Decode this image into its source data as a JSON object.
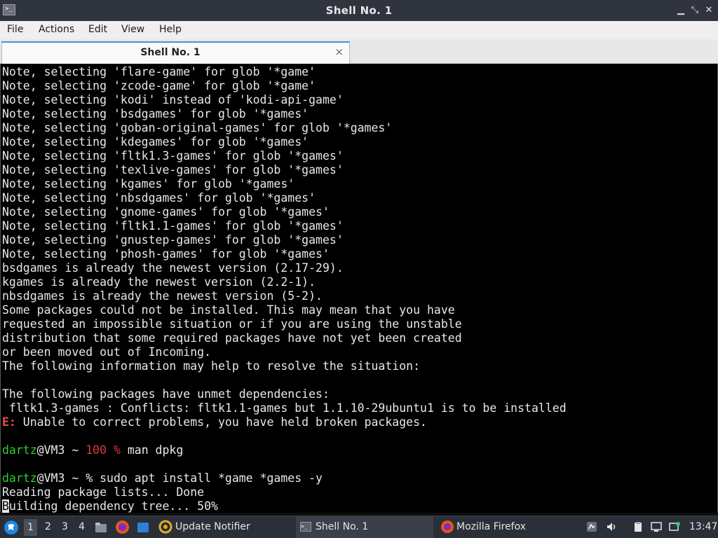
{
  "window": {
    "title": "Shell No. 1",
    "icon": "terminal-icon",
    "controls": [
      "minimize-icon",
      "maximize-icon",
      "close-icon"
    ]
  },
  "menu": [
    "File",
    "Actions",
    "Edit",
    "View",
    "Help"
  ],
  "tab": {
    "label": "Shell No. 1",
    "close": "×"
  },
  "terminal": {
    "lines": [
      {
        "segments": [
          {
            "text": "Note, selecting 'flare-game' for glob '*game'"
          }
        ]
      },
      {
        "segments": [
          {
            "text": "Note, selecting 'zcode-game' for glob '*game'"
          }
        ]
      },
      {
        "segments": [
          {
            "text": "Note, selecting 'kodi' instead of 'kodi-api-game'"
          }
        ]
      },
      {
        "segments": [
          {
            "text": "Note, selecting 'bsdgames' for glob '*games'"
          }
        ]
      },
      {
        "segments": [
          {
            "text": "Note, selecting 'goban-original-games' for glob '*games'"
          }
        ]
      },
      {
        "segments": [
          {
            "text": "Note, selecting 'kdegames' for glob '*games'"
          }
        ]
      },
      {
        "segments": [
          {
            "text": "Note, selecting 'fltk1.3-games' for glob '*games'"
          }
        ]
      },
      {
        "segments": [
          {
            "text": "Note, selecting 'texlive-games' for glob '*games'"
          }
        ]
      },
      {
        "segments": [
          {
            "text": "Note, selecting 'kgames' for glob '*games'"
          }
        ]
      },
      {
        "segments": [
          {
            "text": "Note, selecting 'nbsdgames' for glob '*games'"
          }
        ]
      },
      {
        "segments": [
          {
            "text": "Note, selecting 'gnome-games' for glob '*games'"
          }
        ]
      },
      {
        "segments": [
          {
            "text": "Note, selecting 'fltk1.1-games' for glob '*games'"
          }
        ]
      },
      {
        "segments": [
          {
            "text": "Note, selecting 'gnustep-games' for glob '*games'"
          }
        ]
      },
      {
        "segments": [
          {
            "text": "Note, selecting 'phosh-games' for glob '*games'"
          }
        ]
      },
      {
        "segments": [
          {
            "text": "bsdgames is already the newest version (2.17-29)."
          }
        ]
      },
      {
        "segments": [
          {
            "text": "kgames is already the newest version (2.2-1)."
          }
        ]
      },
      {
        "segments": [
          {
            "text": "nbsdgames is already the newest version (5-2)."
          }
        ]
      },
      {
        "segments": [
          {
            "text": "Some packages could not be installed. This may mean that you have"
          }
        ]
      },
      {
        "segments": [
          {
            "text": "requested an impossible situation or if you are using the unstable"
          }
        ]
      },
      {
        "segments": [
          {
            "text": "distribution that some required packages have not yet been created"
          }
        ]
      },
      {
        "segments": [
          {
            "text": "or been moved out of Incoming."
          }
        ]
      },
      {
        "segments": [
          {
            "text": "The following information may help to resolve the situation:"
          }
        ]
      },
      {
        "segments": [
          {
            "text": ""
          }
        ]
      },
      {
        "segments": [
          {
            "text": "The following packages have unmet dependencies:"
          }
        ]
      },
      {
        "segments": [
          {
            "text": " fltk1.3-games : Conflicts: fltk1.1-games but 1.1.10-29ubuntu1 is to be installed"
          }
        ]
      },
      {
        "segments": [
          {
            "text": "E:",
            "cls": "err"
          },
          {
            "text": " Unable to correct problems, you have held broken packages."
          }
        ]
      },
      {
        "segments": [
          {
            "text": ""
          }
        ]
      },
      {
        "segments": [
          {
            "text": "dartz",
            "cls": "green"
          },
          {
            "text": "@VM3 ~ "
          },
          {
            "text": "100 %",
            "cls": "red"
          },
          {
            "text": " man dpkg"
          }
        ]
      },
      {
        "segments": [
          {
            "text": ""
          }
        ]
      },
      {
        "segments": [
          {
            "text": "dartz",
            "cls": "green"
          },
          {
            "text": "@VM3 ~ % sudo apt install *game *games -y"
          }
        ]
      },
      {
        "segments": [
          {
            "text": "Reading package lists... Done"
          }
        ]
      },
      {
        "segments": [
          {
            "text": "B",
            "cls": "cursor"
          },
          {
            "text": "uilding dependency tree... 50%"
          }
        ]
      }
    ]
  },
  "taskbar": {
    "workspaces": [
      "1",
      "2",
      "3",
      "4"
    ],
    "active_workspace": "1",
    "tasks": [
      {
        "label": "Update Notifier",
        "icon": "update-notifier-icon"
      },
      {
        "label": "Shell No. 1",
        "icon": "terminal-icon",
        "active": true
      },
      {
        "label": "Mozilla Firefox",
        "icon": "firefox-icon"
      }
    ],
    "clock": "13:47"
  }
}
